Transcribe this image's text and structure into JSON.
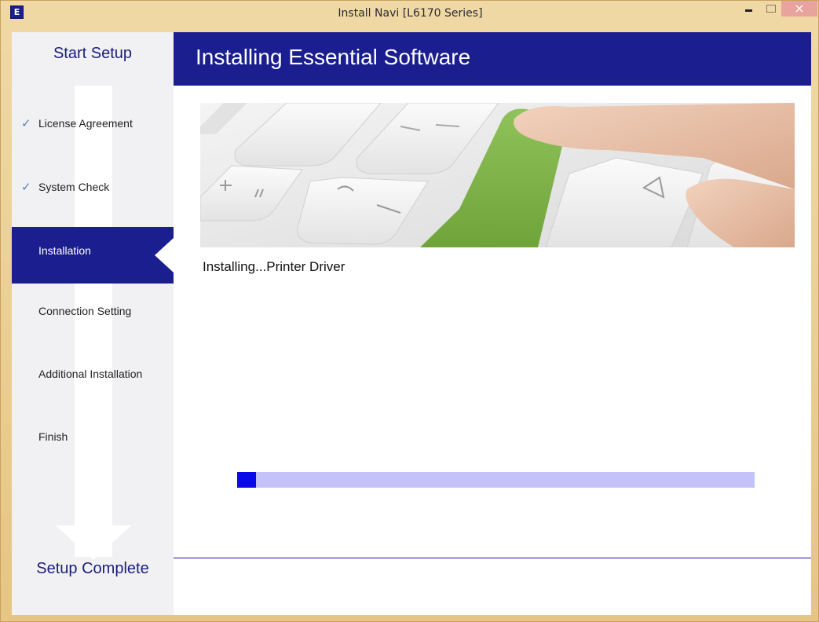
{
  "window": {
    "title": "Install Navi [L6170 Series]",
    "app_icon_letter": "E"
  },
  "sidebar": {
    "start_label": "Start Setup",
    "end_label": "Setup Complete",
    "steps": [
      {
        "label": "License Agreement",
        "state": "done"
      },
      {
        "label": "System Check",
        "state": "done"
      },
      {
        "label": "Installation",
        "state": "active"
      },
      {
        "label": "Connection Setting",
        "state": "pending"
      },
      {
        "label": "Additional Installation",
        "state": "pending"
      },
      {
        "label": "Finish",
        "state": "pending"
      }
    ]
  },
  "main": {
    "title": "Installing Essential Software",
    "status": "Installing...Printer Driver",
    "progress": 0.036
  },
  "colors": {
    "accent": "#1b1e8f",
    "progress_fill": "#0a0ae8",
    "progress_track": "#c3c3fa",
    "frame": "#e6c585"
  },
  "icons": {
    "check": "checkmark-icon",
    "minimize": "minimize-icon",
    "maximize": "maximize-icon",
    "close": "close-icon"
  }
}
